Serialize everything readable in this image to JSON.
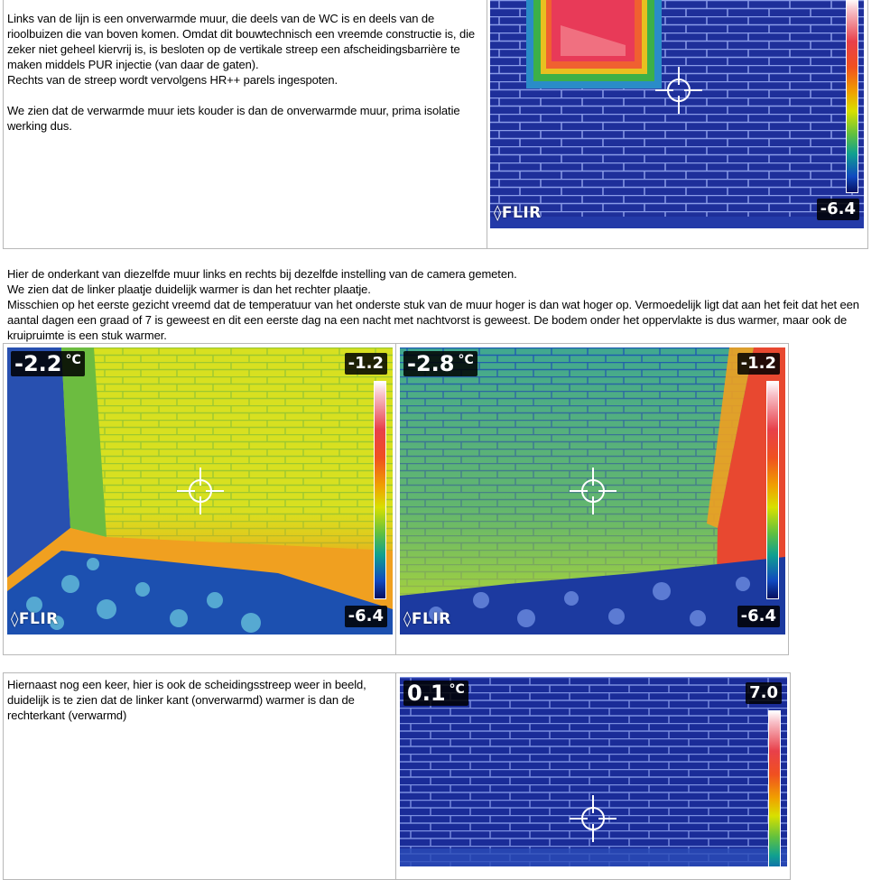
{
  "section1": {
    "text": "Links van de lijn  is  een onverwarmde muur, die deels van de WC  is  en deels van de rioolbuizen die van boven komen. Omdat dit bouwtechnisch een vreemde constructie is, die zeker niet geheel kiervrij is,  is  besloten op de vertikale streep een afscheidingsbarrière  te maken middels PUR injectie (van daar  de gaten).\nRechts van de streep wordt vervolgens HR++ parels  ingespoten.\n\nWe zien dat de verwarmde muur iets kouder is  dan de onverwarmde muur, prima isolatie werking dus.",
    "image": {
      "scale_min": "-6.4",
      "logo": "FLIR"
    }
  },
  "section2": {
    "text": "Hier de onderkant van diezelfde muur links en rechts bij  dezelfde instelling van de camera gemeten.\nWe zien dat de linker plaatje duidelijk warmer is  dan het rechter plaatje.\nMisschien  op het eerste gezicht vreemd dat de temperatuur van het onderste stuk van de muur hoger is dan wat hoger op. Vermoedelijk ligt dat aan  het feit dat het een aantal dagen een graad of 7 is  geweest en dit een eerste dag na een nacht met nachtvorst is geweest. De bodem onder het oppervlakte is dus warmer, maar ook de kruipruimte is  een stuk warmer.",
    "left_image": {
      "temp": "-2.2",
      "unit": "°C",
      "scale_max": "-1.2",
      "scale_min": "-6.4",
      "logo": "FLIR"
    },
    "right_image": {
      "temp": "-2.8",
      "unit": "°C",
      "scale_max": "-1.2",
      "scale_min": "-6.4",
      "logo": "FLIR"
    }
  },
  "section3": {
    "text": "Hiernaast nog een keer, hier is ook de scheidingsstreep weer in beeld, duidelijk is te zien dat de linker kant (onverwarmd) warmer is dan de rechterkant (verwarmd)",
    "image": {
      "temp": "0.1",
      "unit": "°C",
      "scale_max": "7.0"
    }
  },
  "icons": [
    "flir-logo-icon",
    "crosshair-icon"
  ]
}
